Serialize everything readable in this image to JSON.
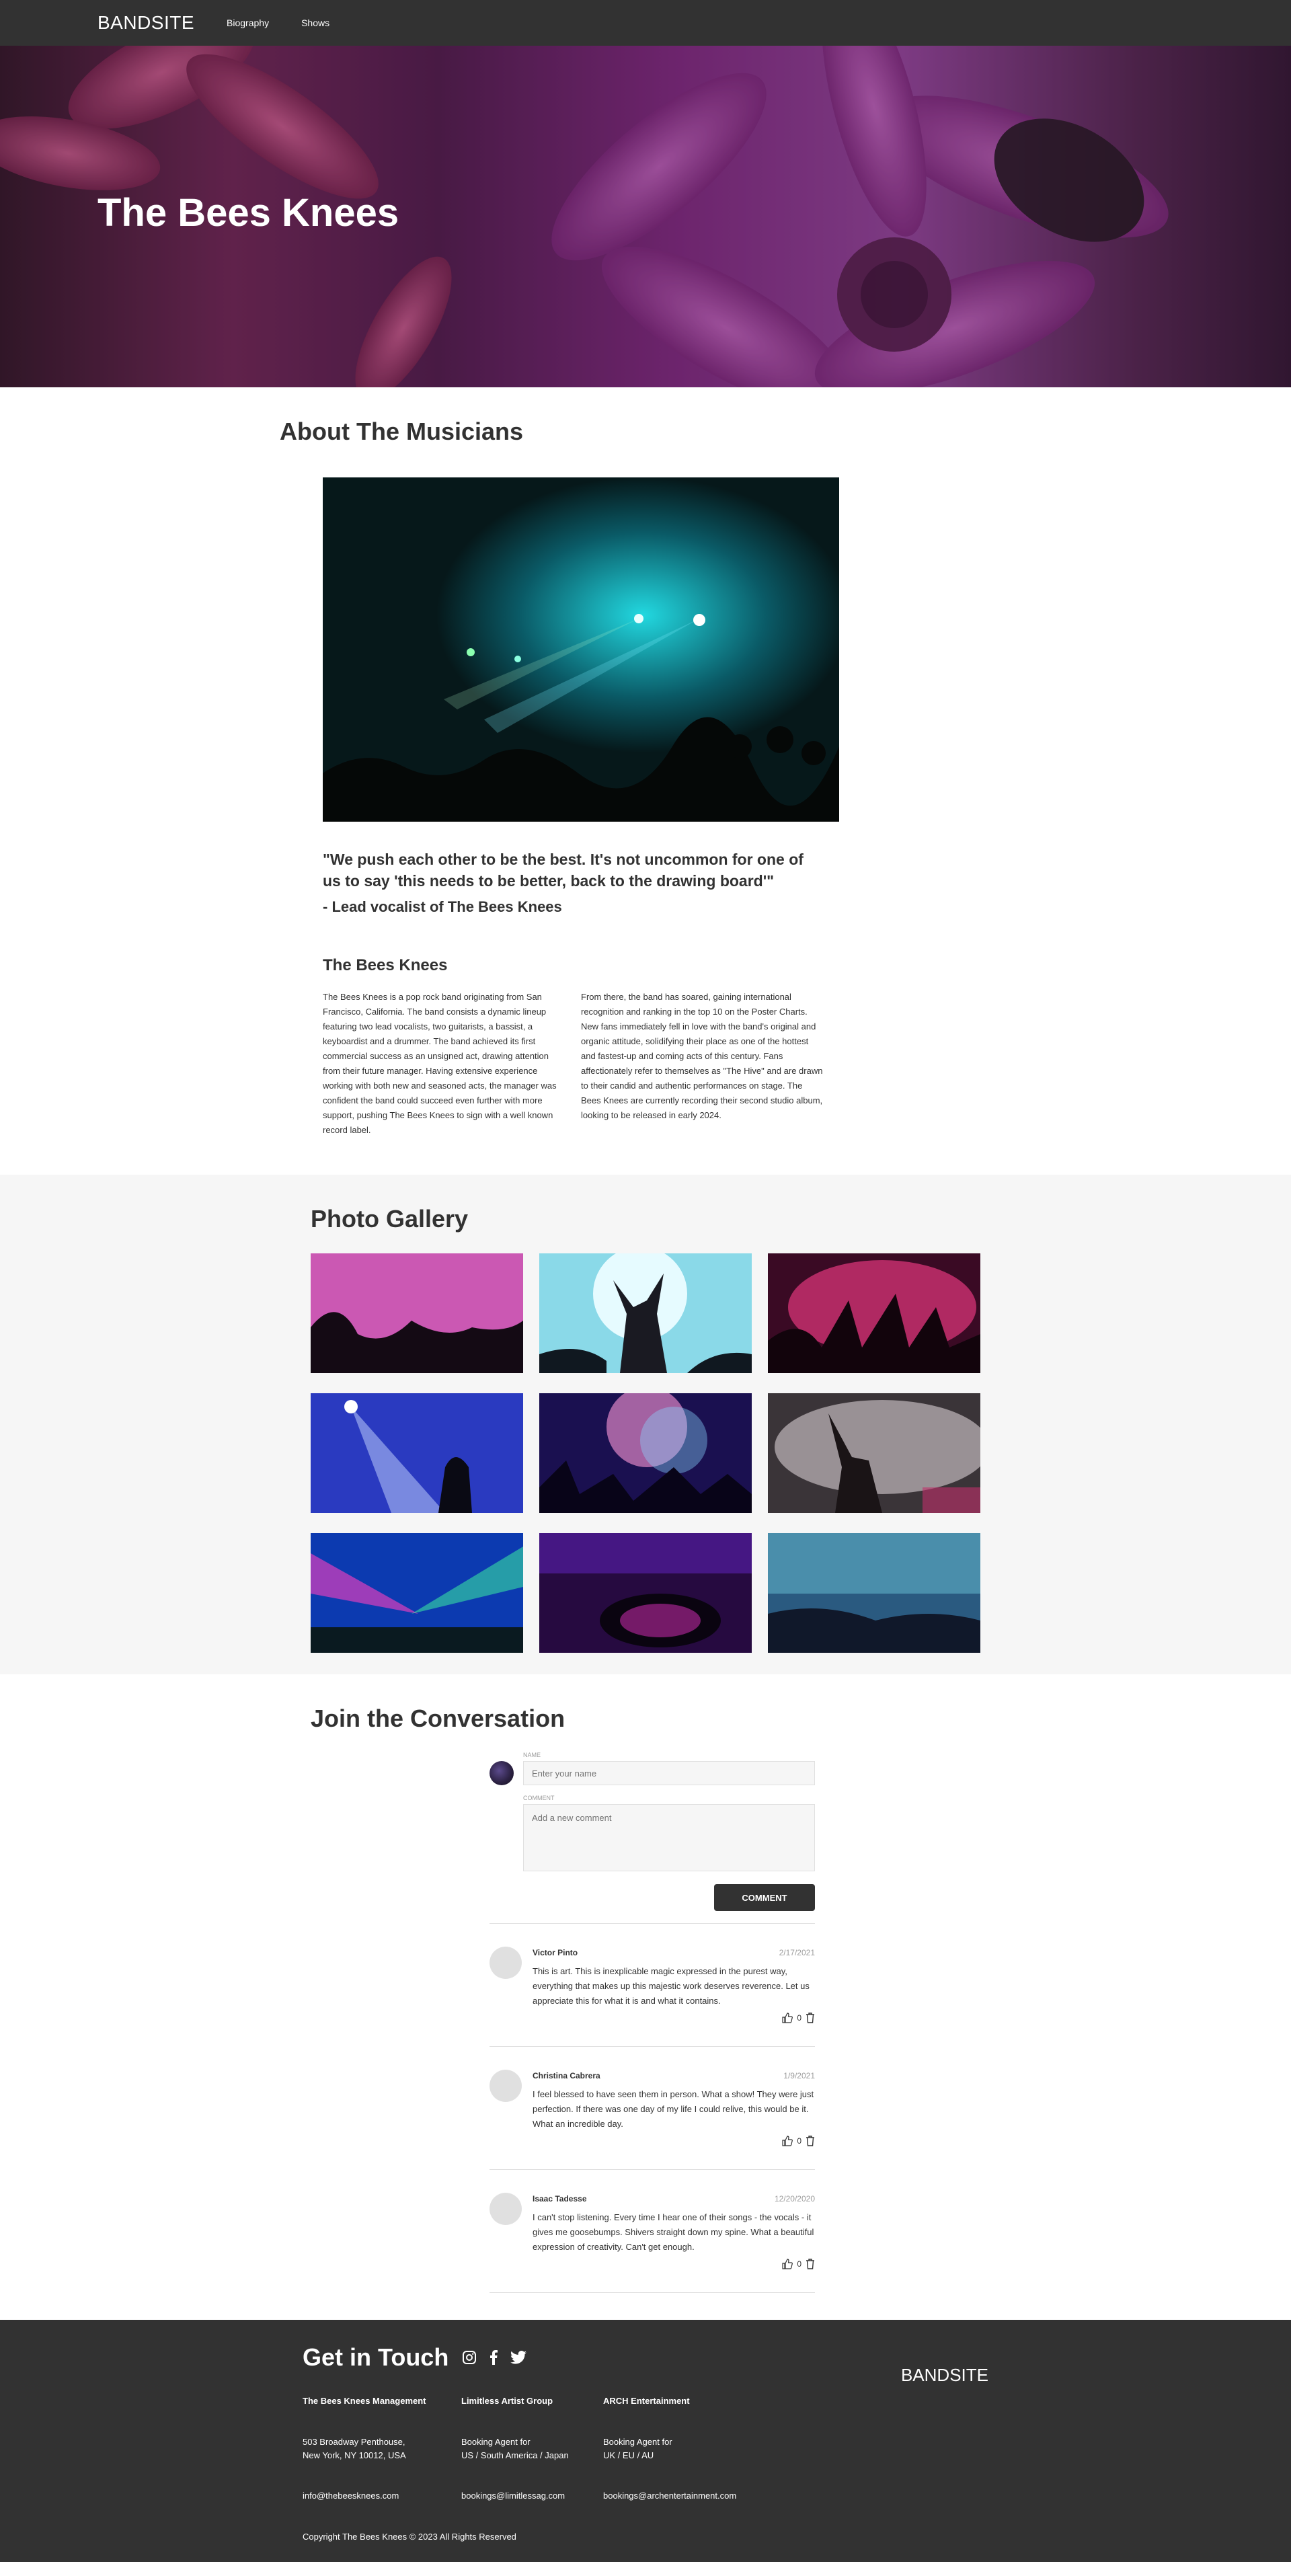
{
  "nav": {
    "logo": "BANDSITE",
    "links": [
      "Biography",
      "Shows"
    ]
  },
  "hero": {
    "title": "The Bees Knees"
  },
  "about": {
    "heading": "About The Musicians",
    "quote": "\"We push each other to be the best. It's not uncommon for one of us to say 'this needs to be better, back to the drawing board'\"",
    "quote_author": "- Lead vocalist of The Bees Knees",
    "bio_title": "The Bees Knees",
    "bio_col1": "The Bees Knees is a pop rock band originating from San Francisco, California. The band consists a dynamic lineup featuring two lead vocalists, two guitarists, a bassist, a keyboardist and a drummer. The band achieved its first commercial success as an unsigned act, drawing attention from their future manager. Having extensive experience working with both new and seasoned acts, the manager was confident the band could succeed even further with more support, pushing The Bees Knees to sign with a well known record label.",
    "bio_col2": "From there, the band has soared, gaining international recognition and ranking in the top 10 on the Poster Charts. New fans immediately fell in love with the band's original and organic attitude, solidifying their place as one of the hottest and fastest-up and coming acts of this century. Fans affectionately refer to themselves as \"The Hive\" and are drawn to their candid and authentic performances on stage. The Bees Knees are currently recording their second studio album, looking to be released in early 2024."
  },
  "gallery": {
    "heading": "Photo Gallery"
  },
  "conversation": {
    "heading": "Join the Conversation",
    "name_label": "NAME",
    "name_placeholder": "Enter your name",
    "comment_label": "COMMENT",
    "comment_placeholder": "Add a new comment",
    "button_label": "COMMENT",
    "comments": [
      {
        "name": "Victor Pinto",
        "date": "2/17/2021",
        "text": "This is art. This is inexplicable magic expressed in the purest way, everything that makes up this majestic work deserves reverence. Let us appreciate this for what it is and what it contains.",
        "likes": "0"
      },
      {
        "name": "Christina Cabrera",
        "date": "1/9/2021",
        "text": "I feel blessed to have seen them in person. What a show! They were just perfection. If there was one day of my life I could relive, this would be it. What an incredible day.",
        "likes": "0"
      },
      {
        "name": "Isaac Tadesse",
        "date": "12/20/2020",
        "text": "I can't stop listening. Every time I hear one of their songs - the vocals - it gives me goosebumps. Shivers straight down my spine. What a beautiful expression of creativity. Can't get enough.",
        "likes": "0"
      }
    ]
  },
  "footer": {
    "heading": "Get in Touch",
    "logo": "BANDSITE",
    "columns": [
      {
        "title": "The Bees Knees Management",
        "line1": "503 Broadway Penthouse,",
        "line2": "New York, NY 10012, USA",
        "email": "info@thebeesknees.com"
      },
      {
        "title": "Limitless Artist Group",
        "line1": "Booking Agent for",
        "line2": "US / South America / Japan",
        "email": "bookings@limitlessag.com"
      },
      {
        "title": "ARCH Entertainment",
        "line1": "Booking Agent for",
        "line2": "UK / EU / AU",
        "email": "bookings@archentertainment.com"
      }
    ],
    "copyright": "Copyright The Bees Knees © 2023 All Rights Reserved"
  }
}
